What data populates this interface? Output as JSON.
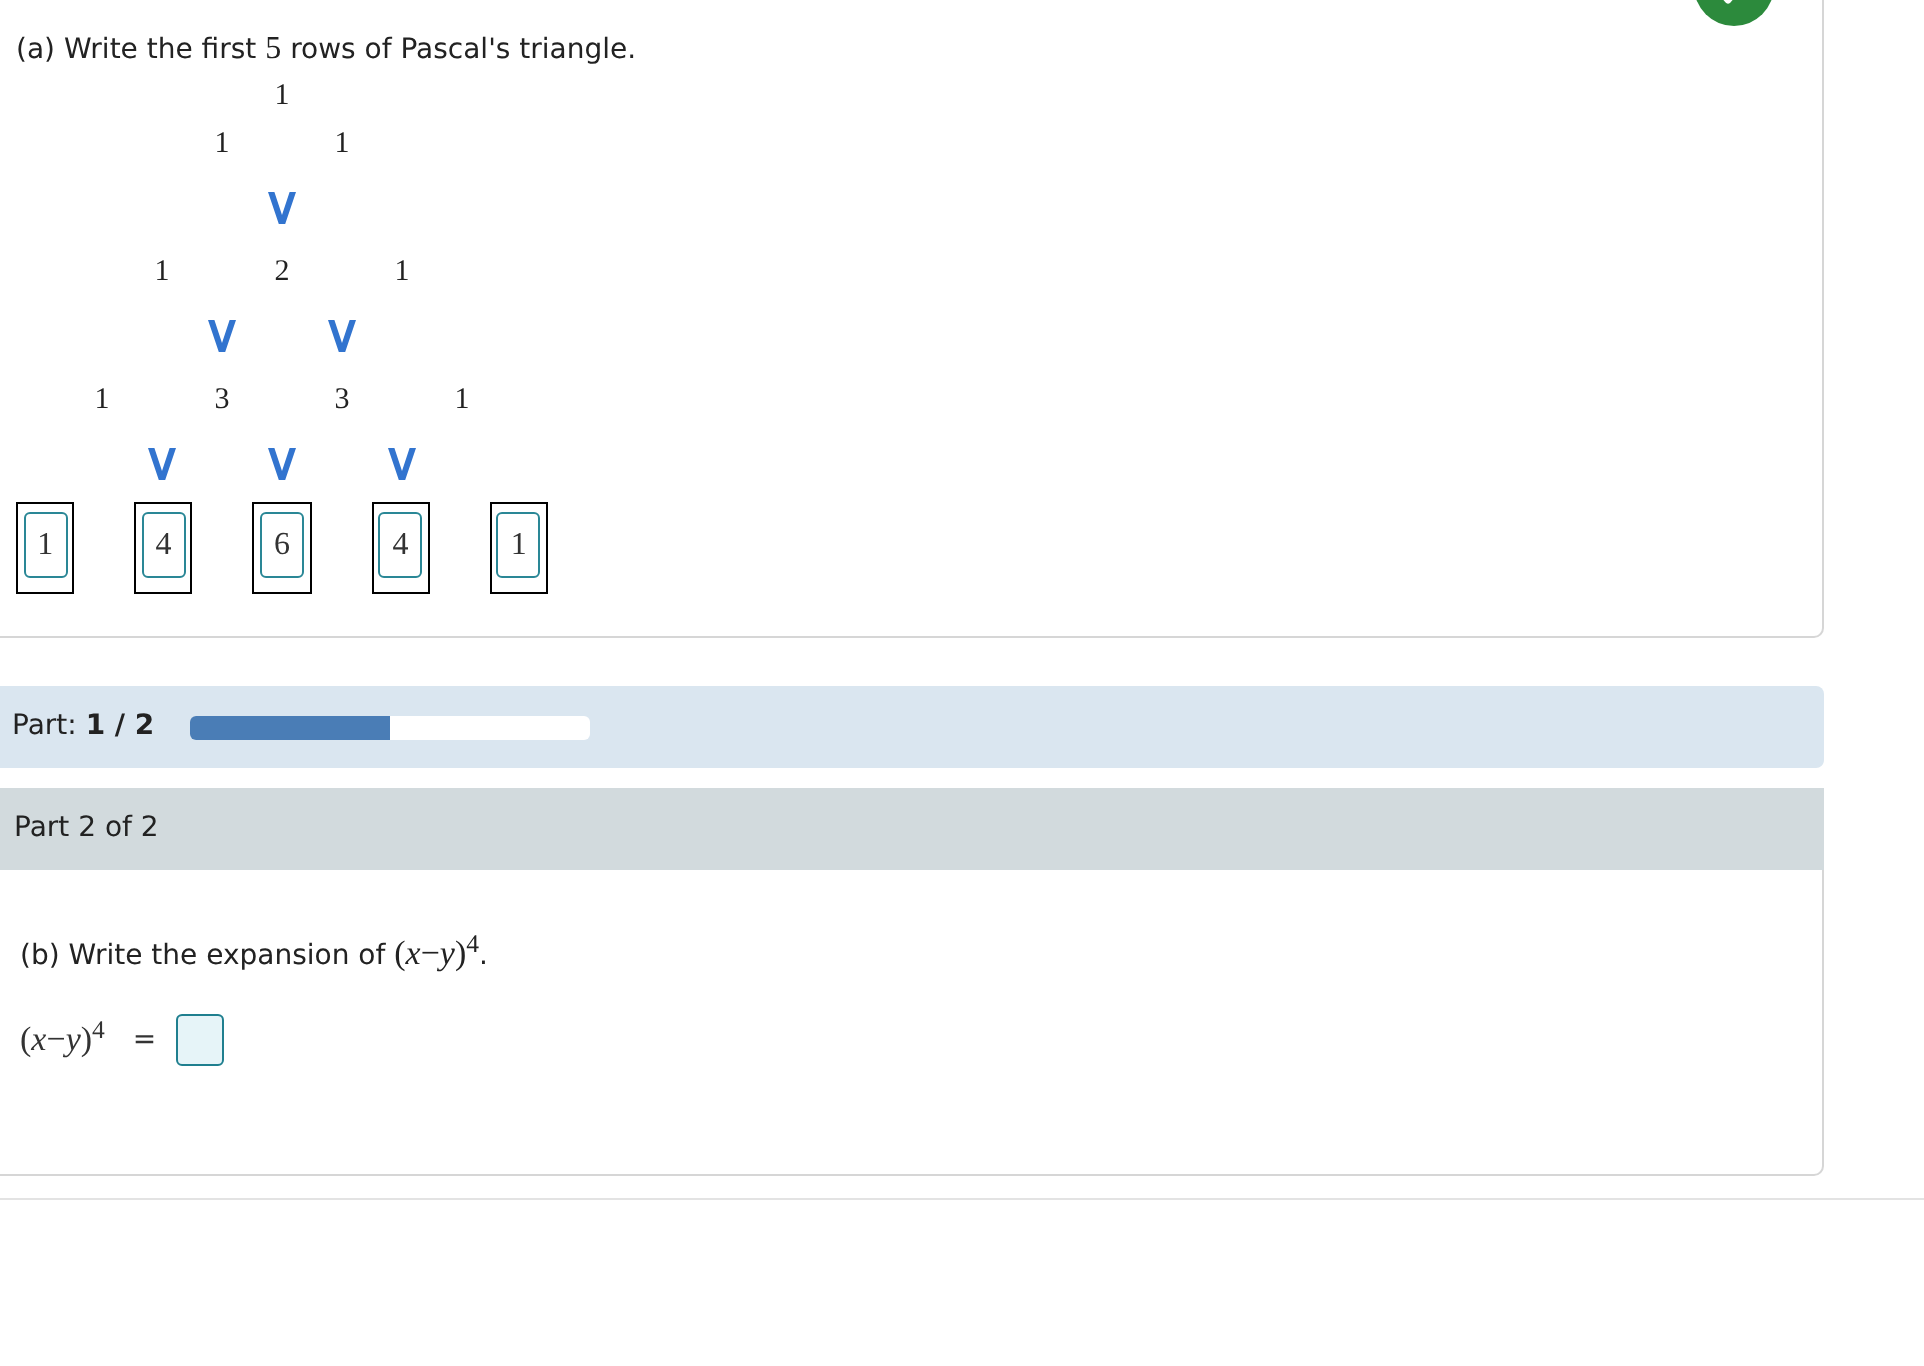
{
  "part_1": {
    "prompt": {
      "before": "(a) Write the first",
      "math": "5",
      "after": "rows of Pascal's triangle."
    },
    "triangle_rows": [
      [
        "1"
      ],
      [
        "1",
        "1"
      ],
      [
        "1",
        "2",
        "1"
      ],
      [
        "1",
        "3",
        "3",
        "1"
      ]
    ],
    "answer_row": [
      "1",
      "4",
      "6",
      "4",
      "1"
    ]
  },
  "progress": {
    "label": "Part: **1 / 2**",
    "level": 0.5
  },
  "part_2": {
    "header": "Part 2 of 2",
    "prompt": {
      "before": "(b) Write the expansion of",
      "math": "(*x*−*y*)$^{4}$",
      "after": "."
    },
    "equation": {
      "lhs": "(*x*−*y*)$^{4}$",
      "operator": "="
    }
  }
}
